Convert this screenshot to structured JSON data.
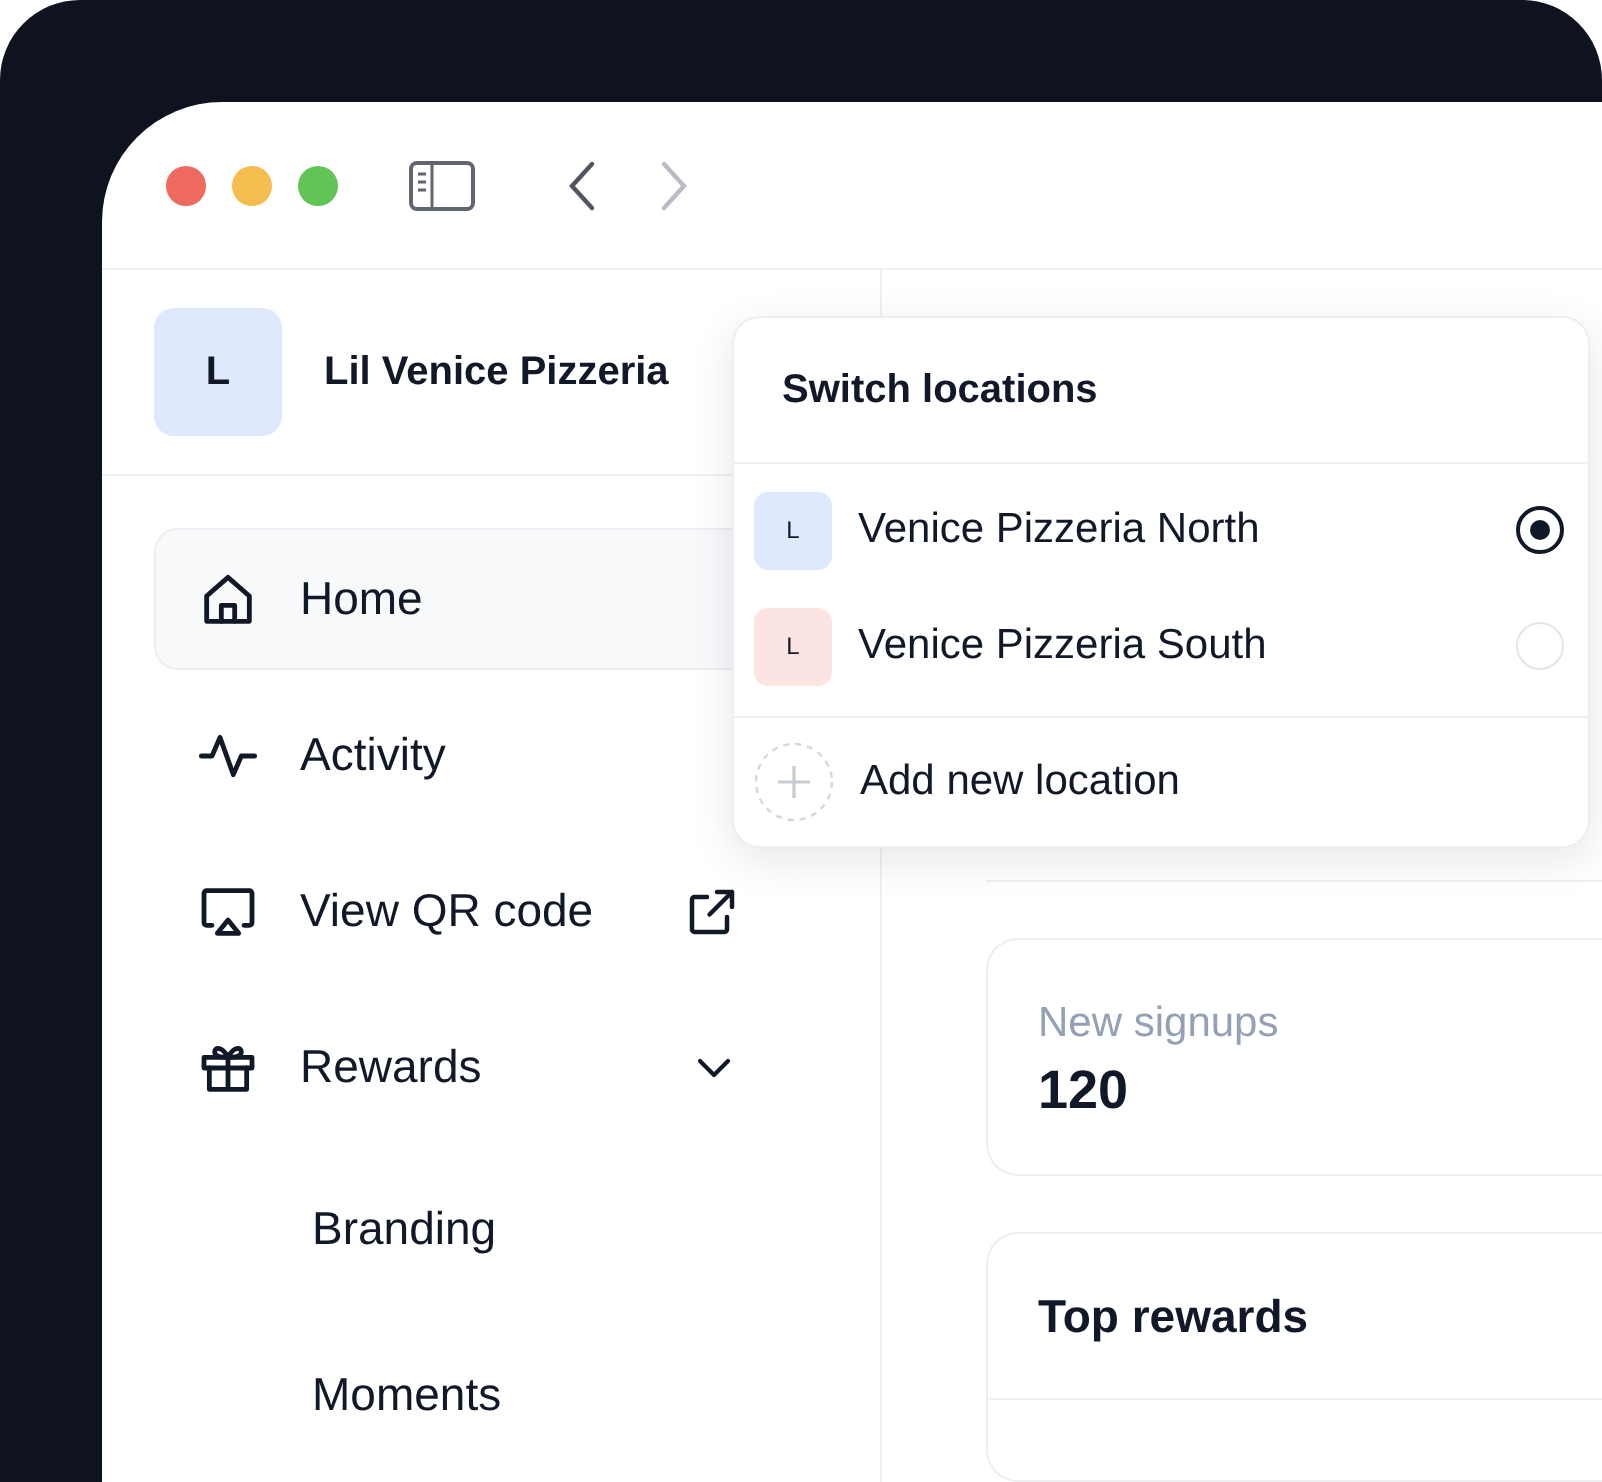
{
  "toolbar": {
    "back": {
      "disabled": false
    },
    "forward": {
      "disabled": true
    }
  },
  "sidebar": {
    "account": {
      "initial": "L",
      "name": "Lil Venice Pizzeria"
    },
    "items": [
      {
        "label": "Home",
        "selected": true
      },
      {
        "label": "Activity",
        "selected": false
      },
      {
        "label": "View QR code",
        "selected": false,
        "external": true
      },
      {
        "label": "Rewards",
        "selected": false,
        "expanded": true,
        "children": [
          {
            "label": "Branding",
            "selected": false
          },
          {
            "label": "Moments",
            "selected": false
          }
        ]
      }
    ]
  },
  "location_menu": {
    "title": "Switch locations",
    "locations": [
      {
        "initial": "L",
        "name": "Venice Pizzeria North",
        "color": "#dfe9fd",
        "selected": true
      },
      {
        "initial": "L",
        "name": "Venice Pizzeria South",
        "color": "#fbe4e1",
        "selected": false
      }
    ],
    "add_label": "Add new location"
  },
  "main": {
    "stats": [
      {
        "label": "New signups",
        "value": "120"
      }
    ],
    "top_rewards": {
      "title": "Top rewards"
    }
  }
}
